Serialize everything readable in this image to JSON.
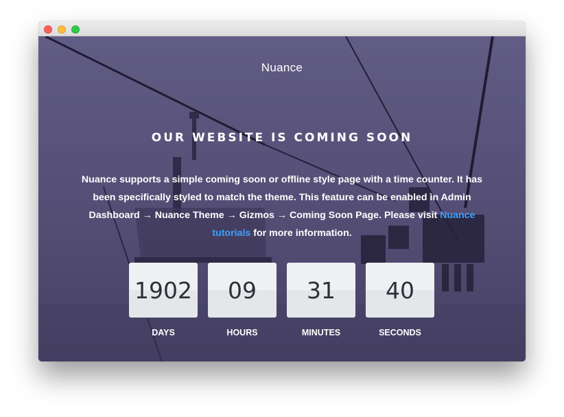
{
  "window": {
    "controls": [
      "close",
      "minimize",
      "maximize"
    ]
  },
  "brand": "Nuance",
  "headline": "OUR WEBSITE IS COMING SOON",
  "description": {
    "text_before_link": "Nuance supports a simple coming soon or offline style page with a time counter. It has been specifically styled to match the theme. This feature can be enabled in Admin Dashboard → Nuance Theme → Gizmos → Coming Soon Page. Please visit ",
    "link_text": "Nuance tutorials",
    "text_after_link": " for more information."
  },
  "countdown": [
    {
      "value": "1902",
      "label": "DAYS"
    },
    {
      "value": "09",
      "label": "HOURS"
    },
    {
      "value": "31",
      "label": "MINUTES"
    },
    {
      "value": "40",
      "label": "SECONDS"
    }
  ],
  "colors": {
    "overlay": "#5a5578",
    "link": "#3ea2ff",
    "counter_box": "#eef0f2",
    "counter_text": "#2e2f38"
  }
}
